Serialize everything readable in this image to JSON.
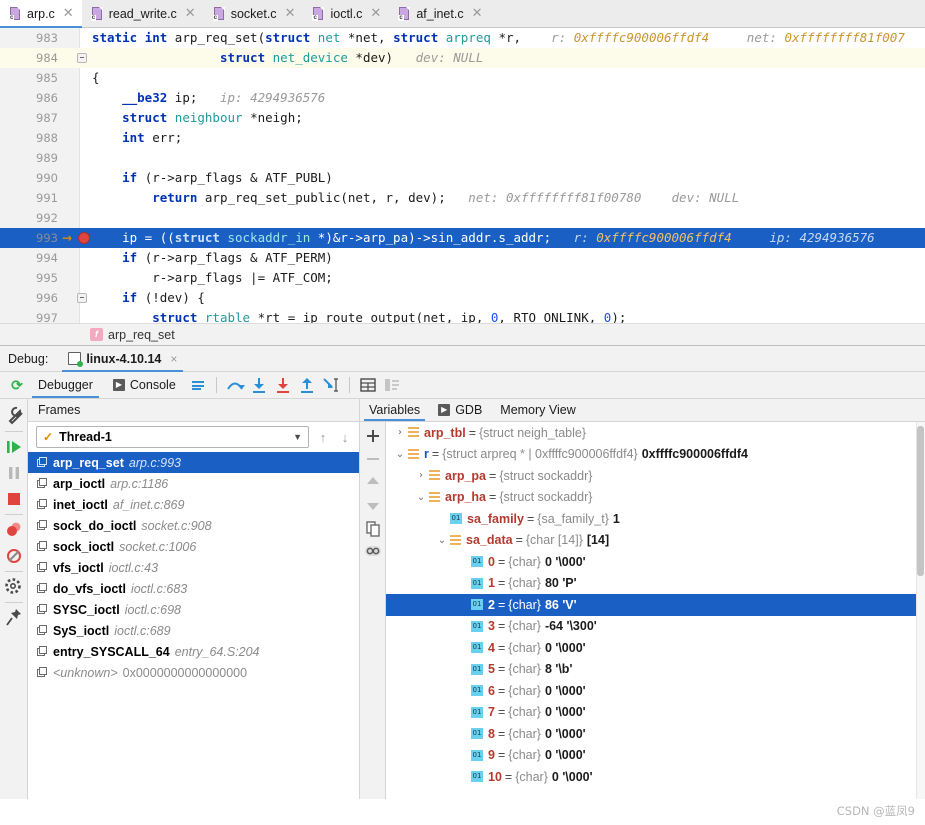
{
  "tabs": [
    {
      "label": "arp.c",
      "icon": "c-file-icon",
      "active": true
    },
    {
      "label": "read_write.c",
      "icon": "c-file-icon",
      "active": false
    },
    {
      "label": "socket.c",
      "icon": "c-file-icon",
      "active": false
    },
    {
      "label": "ioctl.c",
      "icon": "c-file-icon",
      "active": false
    },
    {
      "label": "af_inet.c",
      "icon": "c-file-icon",
      "active": false
    }
  ],
  "editor": {
    "lines": [
      {
        "num": "983",
        "state": "normal",
        "tokens": [
          {
            "t": "static ",
            "c": "kw"
          },
          {
            "t": "int ",
            "c": "kw"
          },
          {
            "t": "arp_req_set(",
            "c": "pln"
          },
          {
            "t": "struct ",
            "c": "kw"
          },
          {
            "t": "net ",
            "c": "typ"
          },
          {
            "t": "*net, ",
            "c": "pln"
          },
          {
            "t": "struct ",
            "c": "kw"
          },
          {
            "t": "arpreq ",
            "c": "typ"
          },
          {
            "t": "*r,",
            "c": "pln"
          },
          {
            "t": "    r: ",
            "c": "hint"
          },
          {
            "t": "0xffffc900006ffdf4",
            "c": "hintv"
          },
          {
            "t": "     net: ",
            "c": "hint"
          },
          {
            "t": "0xffffffff81f007",
            "c": "hintv"
          }
        ]
      },
      {
        "num": "984",
        "state": "caret",
        "fold": true,
        "tokens": [
          {
            "t": "                 ",
            "c": "pln"
          },
          {
            "t": "struct ",
            "c": "kw"
          },
          {
            "t": "net_device ",
            "c": "typ"
          },
          {
            "t": "*dev)",
            "c": "pln"
          },
          {
            "t": "   dev: ",
            "c": "hint"
          },
          {
            "t": "NULL",
            "c": "hint"
          }
        ]
      },
      {
        "num": "985",
        "state": "normal",
        "tokens": [
          {
            "t": "{",
            "c": "pln"
          }
        ]
      },
      {
        "num": "986",
        "state": "normal",
        "tokens": [
          {
            "t": "    ",
            "c": "pln"
          },
          {
            "t": "__be32 ",
            "c": "kw"
          },
          {
            "t": "ip;",
            "c": "pln"
          },
          {
            "t": "   ip: ",
            "c": "hint"
          },
          {
            "t": "4294936576",
            "c": "hint"
          }
        ]
      },
      {
        "num": "987",
        "state": "normal",
        "tokens": [
          {
            "t": "    ",
            "c": "pln"
          },
          {
            "t": "struct ",
            "c": "kw"
          },
          {
            "t": "neighbour ",
            "c": "typ"
          },
          {
            "t": "*neigh;",
            "c": "pln"
          }
        ]
      },
      {
        "num": "988",
        "state": "normal",
        "tokens": [
          {
            "t": "    ",
            "c": "pln"
          },
          {
            "t": "int ",
            "c": "kw"
          },
          {
            "t": "err;",
            "c": "pln"
          }
        ]
      },
      {
        "num": "989",
        "state": "normal",
        "tokens": []
      },
      {
        "num": "990",
        "state": "normal",
        "tokens": [
          {
            "t": "    ",
            "c": "pln"
          },
          {
            "t": "if ",
            "c": "kw"
          },
          {
            "t": "(r->arp_flags & ATF_PUBL)",
            "c": "pln"
          }
        ]
      },
      {
        "num": "991",
        "state": "normal",
        "tokens": [
          {
            "t": "        ",
            "c": "pln"
          },
          {
            "t": "return ",
            "c": "kw"
          },
          {
            "t": "arp_req_set_public(net, r, dev);",
            "c": "pln"
          },
          {
            "t": "   net: ",
            "c": "hint"
          },
          {
            "t": "0xffffffff81f00780",
            "c": "hint"
          },
          {
            "t": "    dev: ",
            "c": "hint"
          },
          {
            "t": "NULL",
            "c": "hint"
          }
        ]
      },
      {
        "num": "992",
        "state": "normal",
        "tokens": []
      },
      {
        "num": "993",
        "state": "exec",
        "arrow": "→",
        "breakpoint": true,
        "tokens": [
          {
            "t": "    ip = ((",
            "c": "pln"
          },
          {
            "t": "struct ",
            "c": "kw"
          },
          {
            "t": "sockaddr_in ",
            "c": "typ"
          },
          {
            "t": "*)&r->arp_pa)->sin_addr.s_addr;",
            "c": "pln"
          },
          {
            "t": "   r: ",
            "c": "hint"
          },
          {
            "t": "0xffffc900006ffdf4",
            "c": "hintv"
          },
          {
            "t": "     ip: ",
            "c": "hint"
          },
          {
            "t": "4294936576",
            "c": "hint"
          }
        ]
      },
      {
        "num": "994",
        "state": "normal",
        "tokens": [
          {
            "t": "    ",
            "c": "pln"
          },
          {
            "t": "if ",
            "c": "kw"
          },
          {
            "t": "(r->arp_flags & ATF_PERM)",
            "c": "pln"
          }
        ]
      },
      {
        "num": "995",
        "state": "normal",
        "tokens": [
          {
            "t": "        r->arp_flags |= ATF_COM;",
            "c": "pln"
          }
        ]
      },
      {
        "num": "996",
        "state": "normal",
        "fold": true,
        "tokens": [
          {
            "t": "    ",
            "c": "pln"
          },
          {
            "t": "if ",
            "c": "kw"
          },
          {
            "t": "(!dev) {",
            "c": "pln"
          }
        ]
      },
      {
        "num": "997",
        "state": "normal",
        "tokens": [
          {
            "t": "        ",
            "c": "pln"
          },
          {
            "t": "struct ",
            "c": "kw"
          },
          {
            "t": "rtable ",
            "c": "typ"
          },
          {
            "t": "*rt = ip_route_output(net, ip, ",
            "c": "pln"
          },
          {
            "t": "0",
            "c": "num"
          },
          {
            "t": ", RTO_ONLINK, ",
            "c": "pln"
          },
          {
            "t": "0",
            "c": "num"
          },
          {
            "t": ");",
            "c": "pln"
          }
        ]
      }
    ],
    "breadcrumb": {
      "icon": "function-badge-icon",
      "badge": "f",
      "label": "arp_req_set"
    }
  },
  "debug": {
    "label": "Debug:",
    "session": {
      "name": "linux-4.10.14",
      "icon": "debug-session-icon",
      "close": "×"
    },
    "rerun_icon": "rerun-icon",
    "tabs": [
      {
        "label": "Debugger",
        "icon": "",
        "active": true
      },
      {
        "label": "Console",
        "icon": "console-icon",
        "active": false
      }
    ],
    "toolbar_icons": [
      "layout-settings-icon",
      "step-over-icon",
      "step-into-icon",
      "force-step-into-icon",
      "step-out-icon",
      "run-to-cursor-icon",
      "evaluate-expression-icon",
      "show-frames-icon"
    ],
    "side_tools": [
      "settings-wrench-icon",
      "resume-program-icon",
      "pause-program-icon",
      "stop-program-icon",
      "view-breakpoints-icon",
      "mute-breakpoints-icon",
      "settings-gear-icon",
      "pin-tab-icon"
    ]
  },
  "frames": {
    "header": "Frames",
    "thread": {
      "label": "Thread-1",
      "check": "✓",
      "caret": "▼"
    },
    "nav": {
      "up": "↑",
      "down": "↓"
    },
    "items": [
      {
        "name": "arp_req_set",
        "loc": "arp.c:993",
        "selected": true
      },
      {
        "name": "arp_ioctl",
        "loc": "arp.c:1186",
        "selected": false
      },
      {
        "name": "inet_ioctl",
        "loc": "af_inet.c:869",
        "selected": false
      },
      {
        "name": "sock_do_ioctl",
        "loc": "socket.c:908",
        "selected": false
      },
      {
        "name": "sock_ioctl",
        "loc": "socket.c:1006",
        "selected": false
      },
      {
        "name": "vfs_ioctl",
        "loc": "ioctl.c:43",
        "selected": false
      },
      {
        "name": "do_vfs_ioctl",
        "loc": "ioctl.c:683",
        "selected": false
      },
      {
        "name": "SYSC_ioctl",
        "loc": "ioctl.c:698",
        "selected": false
      },
      {
        "name": "SyS_ioctl",
        "loc": "ioctl.c:689",
        "selected": false
      },
      {
        "name": "entry_SYSCALL_64",
        "loc": "entry_64.S:204",
        "selected": false
      },
      {
        "name": "<unknown>",
        "loc": "0x0000000000000000",
        "selected": false,
        "unknown": true
      }
    ]
  },
  "variables": {
    "tabs": [
      {
        "label": "Variables",
        "icon": "",
        "active": true
      },
      {
        "label": "GDB",
        "icon": "gdb-icon",
        "active": false
      },
      {
        "label": "Memory View",
        "icon": "",
        "active": false
      }
    ],
    "tools": [
      "add-watch-icon",
      "remove-watch-icon",
      "move-up-icon",
      "move-down-icon",
      "copy-value-icon",
      "watches-icon"
    ],
    "rows": [
      {
        "indent": 0,
        "twisty": "›",
        "icon": "struct-icon",
        "name": "arp_tbl",
        "type": "{struct neigh_table}",
        "value": "",
        "selected": false
      },
      {
        "indent": 0,
        "twisty": "⌄",
        "icon": "struct-icon",
        "name": "r",
        "ptr": true,
        "type": "{struct arpreq * | 0xffffc900006ffdf4}",
        "value": "0xffffc900006ffdf4",
        "selected": false
      },
      {
        "indent": 1,
        "twisty": "›",
        "icon": "struct-icon",
        "name": "arp_pa",
        "type": "{struct sockaddr}",
        "value": "",
        "selected": false
      },
      {
        "indent": 1,
        "twisty": "⌄",
        "icon": "struct-icon",
        "name": "arp_ha",
        "type": "{struct sockaddr}",
        "value": "",
        "selected": false
      },
      {
        "indent": 2,
        "twisty": "",
        "icon": "primitive-icon",
        "name": "sa_family",
        "type": "{sa_family_t}",
        "value": "1",
        "selected": false
      },
      {
        "indent": 2,
        "twisty": "⌄",
        "icon": "struct-icon",
        "name": "sa_data",
        "type": "{char [14]}",
        "value": "[14]",
        "selected": false
      },
      {
        "indent": 3,
        "twisty": "",
        "icon": "primitive-icon",
        "name": "0",
        "type": "{char}",
        "value": "0 '\\000'",
        "selected": false
      },
      {
        "indent": 3,
        "twisty": "",
        "icon": "primitive-icon",
        "name": "1",
        "type": "{char}",
        "value": "80 'P'",
        "selected": false
      },
      {
        "indent": 3,
        "twisty": "",
        "icon": "primitive-icon",
        "name": "2",
        "type": "{char}",
        "value": "86 'V'",
        "selected": true
      },
      {
        "indent": 3,
        "twisty": "",
        "icon": "primitive-icon",
        "name": "3",
        "type": "{char}",
        "value": "-64 '\\300'",
        "selected": false
      },
      {
        "indent": 3,
        "twisty": "",
        "icon": "primitive-icon",
        "name": "4",
        "type": "{char}",
        "value": "0 '\\000'",
        "selected": false
      },
      {
        "indent": 3,
        "twisty": "",
        "icon": "primitive-icon",
        "name": "5",
        "type": "{char}",
        "value": "8 '\\b'",
        "selected": false
      },
      {
        "indent": 3,
        "twisty": "",
        "icon": "primitive-icon",
        "name": "6",
        "type": "{char}",
        "value": "0 '\\000'",
        "selected": false
      },
      {
        "indent": 3,
        "twisty": "",
        "icon": "primitive-icon",
        "name": "7",
        "type": "{char}",
        "value": "0 '\\000'",
        "selected": false
      },
      {
        "indent": 3,
        "twisty": "",
        "icon": "primitive-icon",
        "name": "8",
        "type": "{char}",
        "value": "0 '\\000'",
        "selected": false
      },
      {
        "indent": 3,
        "twisty": "",
        "icon": "primitive-icon",
        "name": "9",
        "type": "{char}",
        "value": "0 '\\000'",
        "selected": false
      },
      {
        "indent": 3,
        "twisty": "",
        "icon": "primitive-icon",
        "name": "10",
        "type": "{char}",
        "value": "0 '\\000'",
        "selected": false
      }
    ]
  },
  "watermark": "CSDN @蓝凤9",
  "colors": {
    "selection": "#1a5fc4",
    "accent": "#4a90d9",
    "breakpoint": "#e0443e",
    "inline_hint": "#c9952c",
    "var_name": "#b33a2f",
    "struct_icon": "#f0b15c"
  }
}
